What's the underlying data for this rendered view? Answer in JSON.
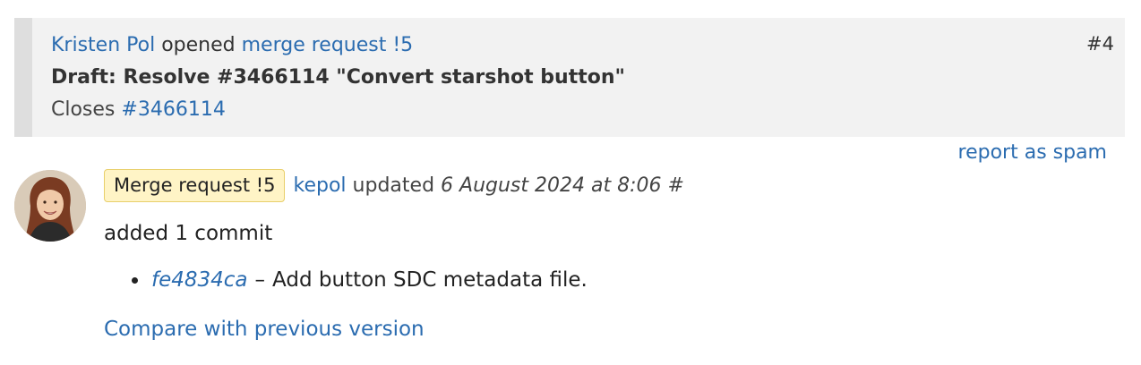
{
  "event": {
    "author": "Kristen Pol",
    "action": "opened",
    "target_link": "merge request !5",
    "title": "Draft: Resolve #3466114 \"Convert starshot button\"",
    "closes_label": "Closes",
    "closes_issue": "#3466114",
    "number": "#4"
  },
  "report_spam": "report as spam",
  "comment": {
    "avatar_icon": "user-avatar-photo",
    "badge": "Merge request !5",
    "author": "kepol",
    "action": "updated",
    "timestamp": "6 August 2024 at 8:06",
    "permalink": "#",
    "body": "added 1 commit",
    "commits": [
      {
        "hash": "fe4834ca",
        "separator": "–",
        "message": "Add button SDC metadata file."
      }
    ],
    "compare_link": "Compare with previous version"
  },
  "colors": {
    "link": "#2b6cb0",
    "event_bg": "#f2f2f2",
    "event_border": "#dedede",
    "badge_bg": "#fff4c6",
    "badge_border": "#e8cf6b"
  }
}
